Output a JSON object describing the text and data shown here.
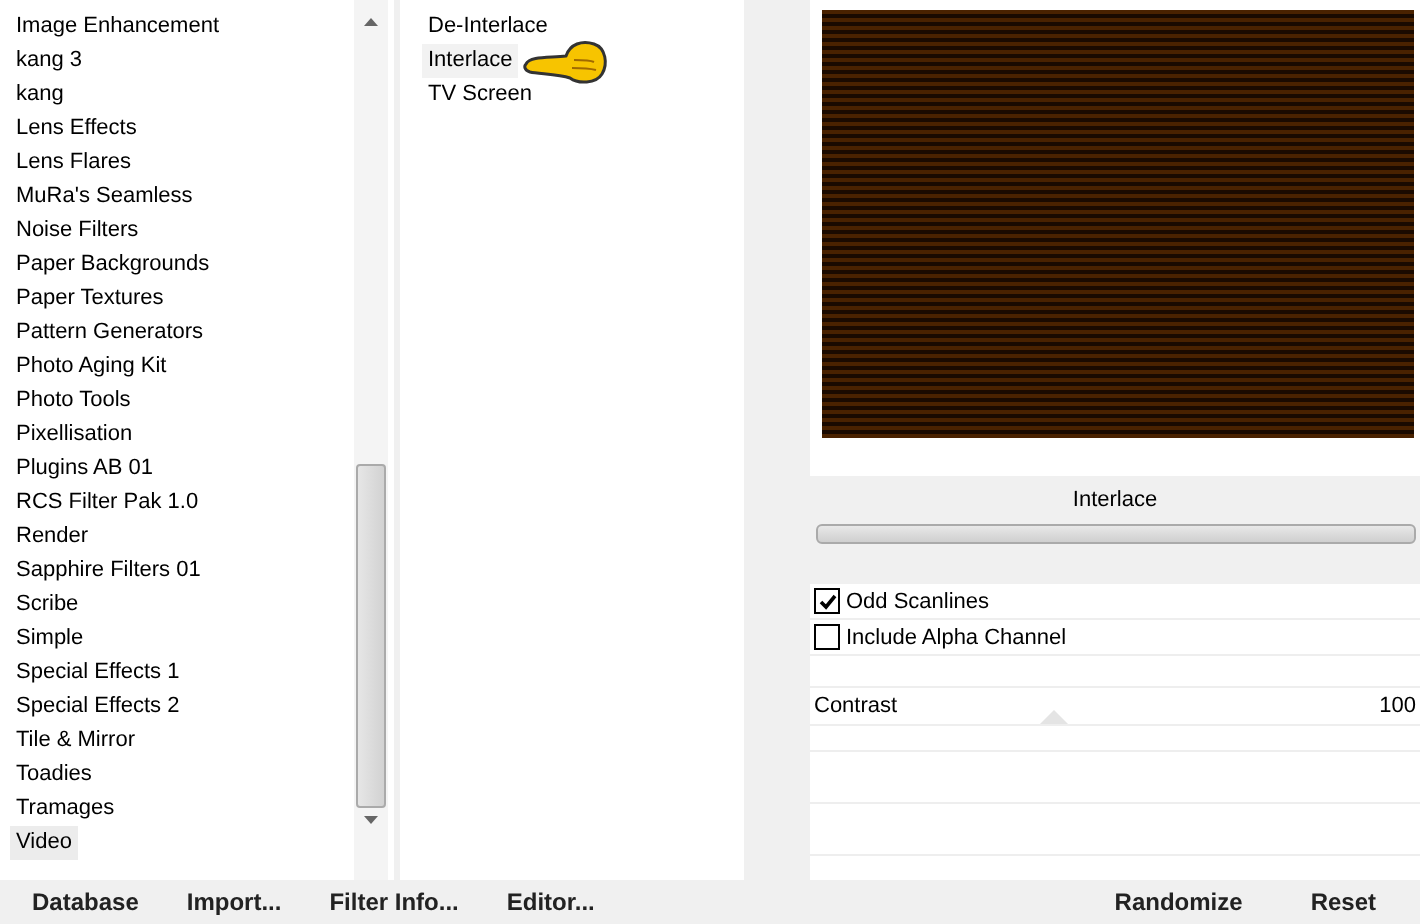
{
  "categories": [
    {
      "label": "Image Enhancement",
      "selected": false
    },
    {
      "label": "kang 3",
      "selected": false
    },
    {
      "label": "kang",
      "selected": false
    },
    {
      "label": "Lens Effects",
      "selected": false
    },
    {
      "label": "Lens Flares",
      "selected": false
    },
    {
      "label": "MuRa's Seamless",
      "selected": false
    },
    {
      "label": "Noise Filters",
      "selected": false
    },
    {
      "label": "Paper Backgrounds",
      "selected": false
    },
    {
      "label": "Paper Textures",
      "selected": false
    },
    {
      "label": "Pattern Generators",
      "selected": false
    },
    {
      "label": "Photo Aging Kit",
      "selected": false
    },
    {
      "label": "Photo Tools",
      "selected": false
    },
    {
      "label": "Pixellisation",
      "selected": false
    },
    {
      "label": "Plugins AB 01",
      "selected": false
    },
    {
      "label": "RCS Filter Pak 1.0",
      "selected": false
    },
    {
      "label": "Render",
      "selected": false
    },
    {
      "label": "Sapphire Filters 01",
      "selected": false
    },
    {
      "label": "Scribe",
      "selected": false
    },
    {
      "label": "Simple",
      "selected": false
    },
    {
      "label": "Special Effects 1",
      "selected": false
    },
    {
      "label": "Special Effects 2",
      "selected": false
    },
    {
      "label": "Tile & Mirror",
      "selected": false
    },
    {
      "label": "Toadies",
      "selected": false
    },
    {
      "label": "Tramages",
      "selected": false
    },
    {
      "label": "Video",
      "selected": true
    }
  ],
  "filters": [
    {
      "label": "De-Interlace",
      "selected": false
    },
    {
      "label": "Interlace",
      "selected": true
    },
    {
      "label": "TV Screen",
      "selected": false
    }
  ],
  "filter_title": "Interlace",
  "options": [
    {
      "label": "Odd Scanlines",
      "checked": true
    },
    {
      "label": "Include Alpha Channel",
      "checked": false
    }
  ],
  "sliders": [
    {
      "label": "Contrast",
      "value": "100",
      "level": 0.4
    }
  ],
  "bottom_left_buttons": [
    "Database",
    "Import...",
    "Filter Info...",
    "Editor..."
  ],
  "bottom_right_buttons": [
    "Randomize",
    "Reset"
  ]
}
